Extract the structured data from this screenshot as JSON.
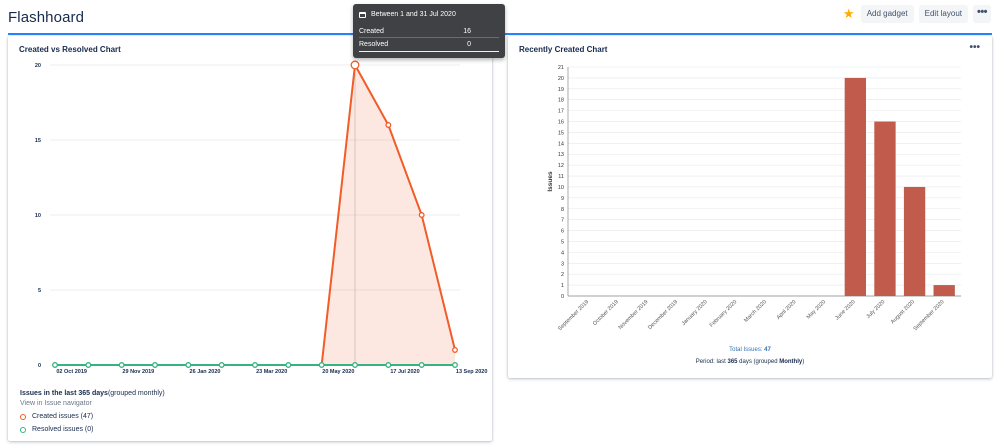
{
  "header": {
    "title": "Flashhoard",
    "add_gadget": "Add gadget",
    "edit_layout": "Edit layout",
    "more": "•••"
  },
  "colors": {
    "accent": "#2684ff",
    "created": "#f15c27",
    "resolved": "#36b37e",
    "bar": "#c15b4b",
    "star": "#ffab00"
  },
  "left_panel": {
    "title": "Created vs Resolved Chart",
    "menu": "•••",
    "legend": {
      "heading_bold": "Issues in the last 365 days",
      "heading_rest": "(grouped monthly)",
      "link": "View in Issue navigator",
      "created": "Created issues (47)",
      "resolved": "Resolved issues (0)"
    }
  },
  "tooltip": {
    "title": "Between 1 and 31 Jul 2020",
    "created_label": "Created",
    "created_value": "16",
    "resolved_label": "Resolved",
    "resolved_value": "0"
  },
  "right_panel": {
    "title": "Recently Created Chart",
    "menu": "•••",
    "total_label": "Total Issues: ",
    "total_value": "47",
    "period_pre": "Period: last ",
    "period_days": "365",
    "period_mid": " days (grouped ",
    "period_group": "Monthly",
    "period_post": ")"
  },
  "chart_data": [
    {
      "type": "area",
      "title": "Created vs Resolved Chart",
      "x_ticks": [
        "02 Oct 2019",
        "29 Nov 2019",
        "26 Jan 2020",
        "23 Mar 2020",
        "20 May 2020",
        "17 Jul 2020",
        "13 Sep 2020"
      ],
      "ylim": [
        0,
        20
      ],
      "y_ticks": [
        0,
        5,
        10,
        15,
        20
      ],
      "series": [
        {
          "name": "Created issues (47)",
          "values": [
            0,
            0,
            0,
            0,
            0,
            0,
            0,
            0,
            0,
            20,
            16,
            10,
            1
          ]
        },
        {
          "name": "Resolved issues (0)",
          "values": [
            0,
            0,
            0,
            0,
            0,
            0,
            0,
            0,
            0,
            0,
            0,
            0,
            0
          ]
        }
      ],
      "grid": true
    },
    {
      "type": "bar",
      "title": "Recently Created Chart",
      "ylabel": "Issues",
      "categories": [
        "September 2019",
        "October 2019",
        "November 2019",
        "December 2019",
        "January 2020",
        "February 2020",
        "March 2020",
        "April 2020",
        "May 2020",
        "June 2020",
        "July 2020",
        "August 2020",
        "September 2020"
      ],
      "values": [
        0,
        0,
        0,
        0,
        0,
        0,
        0,
        0,
        0,
        20,
        16,
        10,
        1
      ],
      "ylim": [
        0,
        21
      ],
      "grid": true
    }
  ]
}
